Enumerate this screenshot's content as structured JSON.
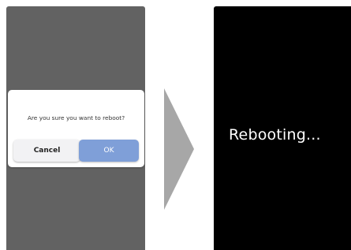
{
  "before_screen": {
    "dialog": {
      "message": "Are you sure you want to reboot?",
      "cancel_label": "Cancel",
      "ok_label": "OK"
    }
  },
  "transition": {
    "icon": "right-arrow-icon"
  },
  "after_screen": {
    "status_text": "Rebooting..."
  },
  "colors": {
    "left_screen_bg": "#626262",
    "right_screen_bg": "#000000",
    "ok_button": "#7f9fd8",
    "cancel_button": "#f2f2f4",
    "arrow": "#a7a7a7"
  }
}
